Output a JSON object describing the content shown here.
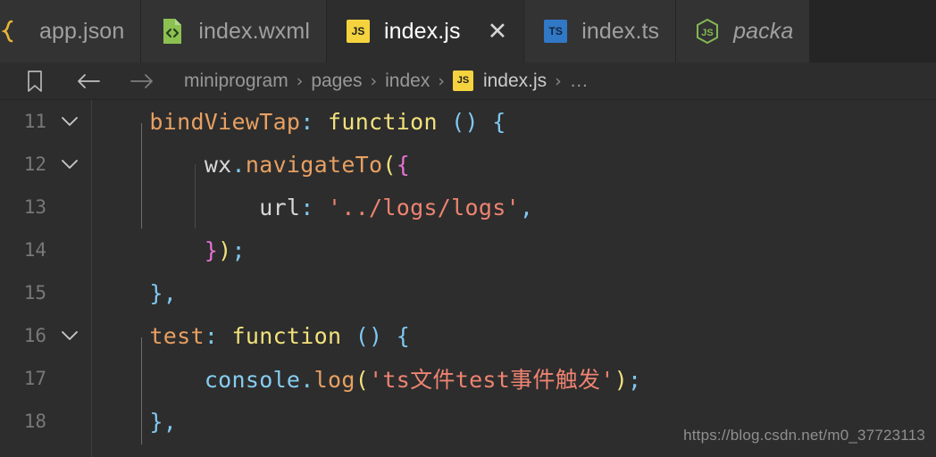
{
  "window": {
    "background": "#2d2d2d",
    "editor_background": "#2d2d2d",
    "tabbar_background": "#252526"
  },
  "tabs": [
    {
      "label": "app.json",
      "icon": "json-braces-icon",
      "state": "inactive",
      "truncated_left": true
    },
    {
      "label": "index.wxml",
      "icon": "wxml-file-icon",
      "state": "inactive"
    },
    {
      "label": "index.js",
      "icon": "js-icon",
      "state": "active",
      "close_glyph": "✕"
    },
    {
      "label": "index.ts",
      "icon": "ts-icon",
      "state": "inactive"
    },
    {
      "label": "packa",
      "icon": "nodejs-icon",
      "state": "preview",
      "truncated_right": true
    }
  ],
  "breadcrumb": {
    "bookmark_icon": "bookmark-icon",
    "back_icon": "arrow-left-icon",
    "forward_icon": "arrow-right-icon",
    "separator": "›",
    "items": [
      {
        "label": "miniprogram",
        "kind": "folder"
      },
      {
        "label": "pages",
        "kind": "folder"
      },
      {
        "label": "index",
        "kind": "folder"
      },
      {
        "label": "index.js",
        "kind": "file",
        "icon": "js-icon"
      },
      {
        "label": "…",
        "kind": "symbols"
      }
    ]
  },
  "editor": {
    "language": "javascript",
    "first_visible_line": 11,
    "last_visible_line": 18,
    "lines": [
      {
        "number": "11",
        "folded": false,
        "fold_glyph": "⌄",
        "has_fold": true,
        "tokens": [
          {
            "text": "    ",
            "cls": "t-plain"
          },
          {
            "text": "bindViewTap",
            "cls": "t-prop"
          },
          {
            "text": ":",
            "cls": "t-punc"
          },
          {
            "text": " ",
            "cls": "t-plain"
          },
          {
            "text": "function",
            "cls": "t-kw"
          },
          {
            "text": " ",
            "cls": "t-plain"
          },
          {
            "text": "()",
            "cls": "t-punc"
          },
          {
            "text": " ",
            "cls": "t-plain"
          },
          {
            "text": "{",
            "cls": "t-punc"
          }
        ]
      },
      {
        "number": "12",
        "folded": false,
        "fold_glyph": "⌄",
        "has_fold": true,
        "tokens": [
          {
            "text": "        ",
            "cls": "t-plain"
          },
          {
            "text": "wx",
            "cls": "t-plain"
          },
          {
            "text": ".",
            "cls": "t-punc"
          },
          {
            "text": "navigateTo",
            "cls": "t-fn"
          },
          {
            "text": "(",
            "cls": "t-paren"
          },
          {
            "text": "{",
            "cls": "t-brace"
          }
        ]
      },
      {
        "number": "13",
        "has_fold": false,
        "tokens": [
          {
            "text": "            ",
            "cls": "t-plain"
          },
          {
            "text": "url",
            "cls": "t-plain"
          },
          {
            "text": ":",
            "cls": "t-punc"
          },
          {
            "text": " ",
            "cls": "t-plain"
          },
          {
            "text": "'../logs/logs'",
            "cls": "t-str"
          },
          {
            "text": ",",
            "cls": "t-punc"
          }
        ]
      },
      {
        "number": "14",
        "has_fold": false,
        "tokens": [
          {
            "text": "        ",
            "cls": "t-plain"
          },
          {
            "text": "}",
            "cls": "t-brace"
          },
          {
            "text": ")",
            "cls": "t-paren"
          },
          {
            "text": ";",
            "cls": "t-punc"
          }
        ]
      },
      {
        "number": "15",
        "has_fold": false,
        "tokens": [
          {
            "text": "    ",
            "cls": "t-plain"
          },
          {
            "text": "}",
            "cls": "t-punc"
          },
          {
            "text": ",",
            "cls": "t-punc"
          }
        ]
      },
      {
        "number": "16",
        "folded": false,
        "fold_glyph": "⌄",
        "has_fold": true,
        "tokens": [
          {
            "text": "    ",
            "cls": "t-plain"
          },
          {
            "text": "test",
            "cls": "t-prop"
          },
          {
            "text": ":",
            "cls": "t-punc"
          },
          {
            "text": " ",
            "cls": "t-plain"
          },
          {
            "text": "function",
            "cls": "t-kw"
          },
          {
            "text": " ",
            "cls": "t-plain"
          },
          {
            "text": "()",
            "cls": "t-punc"
          },
          {
            "text": " ",
            "cls": "t-plain"
          },
          {
            "text": "{",
            "cls": "t-punc"
          }
        ]
      },
      {
        "number": "17",
        "has_fold": false,
        "tokens": [
          {
            "text": "        ",
            "cls": "t-plain"
          },
          {
            "text": "console",
            "cls": "t-obj"
          },
          {
            "text": ".",
            "cls": "t-punc"
          },
          {
            "text": "log",
            "cls": "t-fn"
          },
          {
            "text": "(",
            "cls": "t-paren"
          },
          {
            "text": "'ts文件test事件触发'",
            "cls": "t-str"
          },
          {
            "text": ")",
            "cls": "t-paren"
          },
          {
            "text": ";",
            "cls": "t-punc"
          }
        ]
      },
      {
        "number": "18",
        "has_fold": false,
        "tokens": [
          {
            "text": "    ",
            "cls": "t-plain"
          },
          {
            "text": "}",
            "cls": "t-punc"
          },
          {
            "text": ",",
            "cls": "t-punc"
          }
        ]
      }
    ]
  },
  "watermark": {
    "text": "https://blog.csdn.net/m0_37723113"
  },
  "colors": {
    "accent_js": "#f5d33f",
    "accent_ts": "#3178c6",
    "accent_wxml": "#8cc152",
    "accent_node": "#83b754",
    "accent_json": "#e8b339",
    "string": "#ee8371",
    "keyword": "#f2e27c",
    "property": "#e8a062",
    "punctuation": "#7fc8f0",
    "brace": "#e472d0",
    "object": "#85cdf0"
  }
}
